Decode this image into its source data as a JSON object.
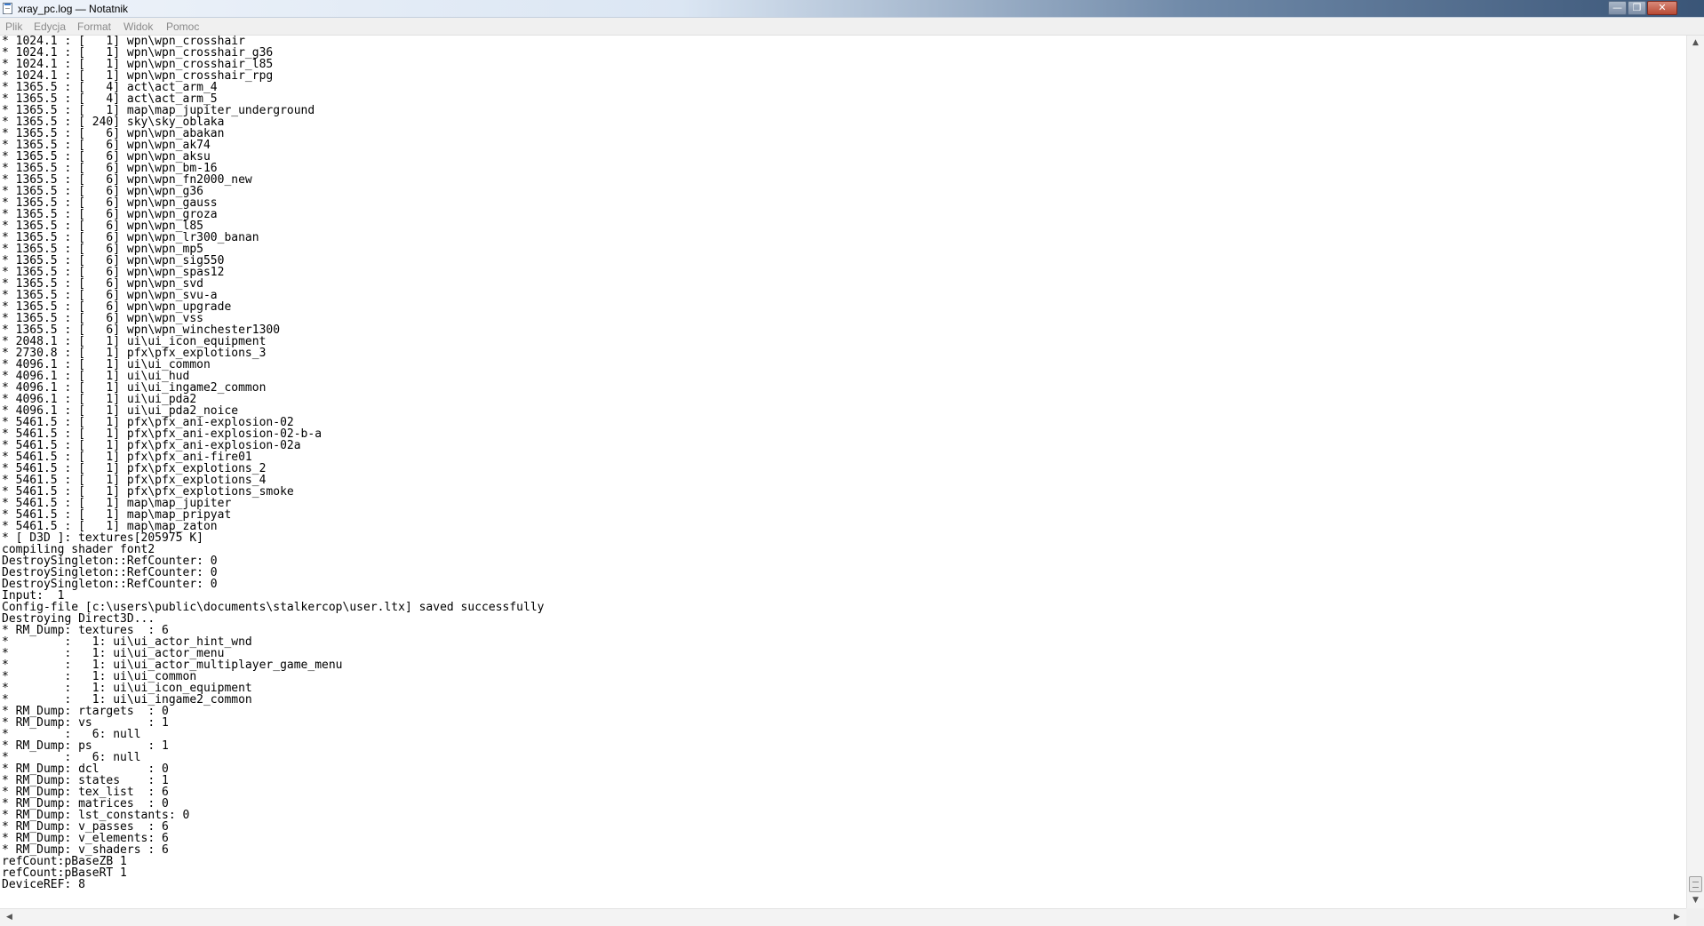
{
  "window": {
    "title": "xray_pc.log — Notatnik"
  },
  "controls": {
    "minimize": "—",
    "maximize": "❐",
    "close": "✕"
  },
  "menu": {
    "plik": "Plik",
    "edycja": "Edycja",
    "format": "Format",
    "widok": "Widok",
    "pomoc": "Pomoc"
  },
  "scrollbar": {
    "up": "▲",
    "down": "▼",
    "left": "◀",
    "right": "▶"
  },
  "log_lines": [
    "* 1024.1 : [   1] wpn\\wpn_crosshair",
    "* 1024.1 : [   1] wpn\\wpn_crosshair_g36",
    "* 1024.1 : [   1] wpn\\wpn_crosshair_l85",
    "* 1024.1 : [   1] wpn\\wpn_crosshair_rpg",
    "* 1365.5 : [   4] act\\act_arm_4",
    "* 1365.5 : [   4] act\\act_arm_5",
    "* 1365.5 : [   1] map\\map_jupiter_underground",
    "* 1365.5 : [ 240] sky\\sky_oblaka",
    "* 1365.5 : [   6] wpn\\wpn_abakan",
    "* 1365.5 : [   6] wpn\\wpn_ak74",
    "* 1365.5 : [   6] wpn\\wpn_aksu",
    "* 1365.5 : [   6] wpn\\wpn_bm-16",
    "* 1365.5 : [   6] wpn\\wpn_fn2000_new",
    "* 1365.5 : [   6] wpn\\wpn_g36",
    "* 1365.5 : [   6] wpn\\wpn_gauss",
    "* 1365.5 : [   6] wpn\\wpn_groza",
    "* 1365.5 : [   6] wpn\\wpn_l85",
    "* 1365.5 : [   6] wpn\\wpn_lr300_banan",
    "* 1365.5 : [   6] wpn\\wpn_mp5",
    "* 1365.5 : [   6] wpn\\wpn_sig550",
    "* 1365.5 : [   6] wpn\\wpn_spas12",
    "* 1365.5 : [   6] wpn\\wpn_svd",
    "* 1365.5 : [   6] wpn\\wpn_svu-a",
    "* 1365.5 : [   6] wpn\\wpn_upgrade",
    "* 1365.5 : [   6] wpn\\wpn_vss",
    "* 1365.5 : [   6] wpn\\wpn_winchester1300",
    "* 2048.1 : [   1] ui\\ui_icon_equipment",
    "* 2730.8 : [   1] pfx\\pfx_explotions_3",
    "* 4096.1 : [   1] ui\\ui_common",
    "* 4096.1 : [   1] ui\\ui_hud",
    "* 4096.1 : [   1] ui\\ui_ingame2_common",
    "* 4096.1 : [   1] ui\\ui_pda2",
    "* 4096.1 : [   1] ui\\ui_pda2_noice",
    "* 5461.5 : [   1] pfx\\pfx_ani-explosion-02",
    "* 5461.5 : [   1] pfx\\pfx_ani-explosion-02-b-a",
    "* 5461.5 : [   1] pfx\\pfx_ani-explosion-02a",
    "* 5461.5 : [   1] pfx\\pfx_ani-fire01",
    "* 5461.5 : [   1] pfx\\pfx_explotions_2",
    "* 5461.5 : [   1] pfx\\pfx_explotions_4",
    "* 5461.5 : [   1] pfx\\pfx_explotions_smoke",
    "* 5461.5 : [   1] map\\map_jupiter",
    "* 5461.5 : [   1] map\\map_pripyat",
    "* 5461.5 : [   1] map\\map_zaton",
    "* [ D3D ]: textures[205975 K]",
    "compiling shader font2",
    "DestroySingleton::RefCounter: 0",
    "DestroySingleton::RefCounter: 0",
    "DestroySingleton::RefCounter: 0",
    "Input:  1",
    "Config-file [c:\\users\\public\\documents\\stalkercop\\user.ltx] saved successfully",
    "Destroying Direct3D...",
    "* RM_Dump: textures  : 6",
    "*        :   1: ui\\ui_actor_hint_wnd",
    "*        :   1: ui\\ui_actor_menu",
    "*        :   1: ui\\ui_actor_multiplayer_game_menu",
    "*        :   1: ui\\ui_common",
    "*        :   1: ui\\ui_icon_equipment",
    "*        :   1: ui\\ui_ingame2_common",
    "* RM_Dump: rtargets  : 0",
    "* RM_Dump: vs        : 1",
    "*        :   6: null",
    "* RM_Dump: ps        : 1",
    "*        :   6: null",
    "* RM_Dump: dcl       : 0",
    "* RM_Dump: states    : 1",
    "* RM_Dump: tex_list  : 6",
    "* RM_Dump: matrices  : 0",
    "* RM_Dump: lst_constants: 0",
    "* RM_Dump: v_passes  : 6",
    "* RM_Dump: v_elements: 6",
    "* RM_Dump: v_shaders : 6",
    "refCount:pBaseZB 1",
    "refCount:pBaseRT 1",
    "DeviceREF: 8"
  ]
}
